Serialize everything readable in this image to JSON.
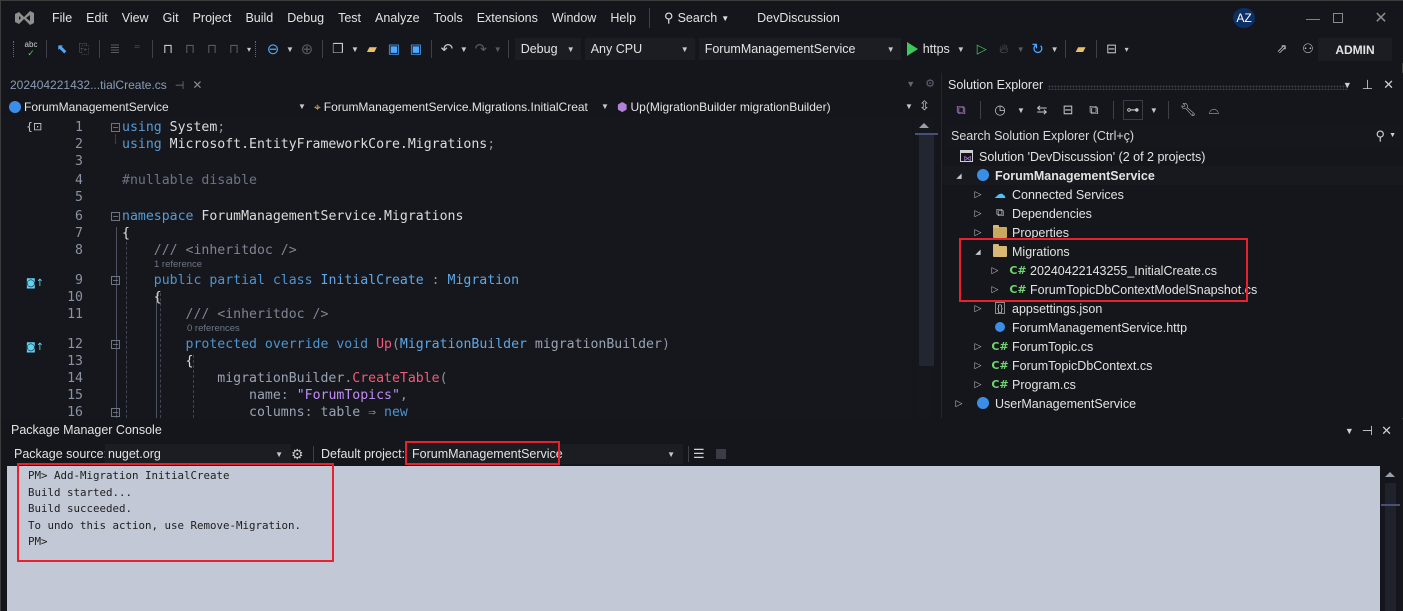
{
  "menubar": {
    "items": [
      "File",
      "Edit",
      "View",
      "Git",
      "Project",
      "Build",
      "Debug",
      "Test",
      "Analyze",
      "Tools",
      "Extensions",
      "Window",
      "Help"
    ],
    "search_label": "Search",
    "solution_name": "DevDiscussion",
    "avatar_initials": "AZ"
  },
  "toolbar": {
    "configuration": "Debug",
    "platform": "Any CPU",
    "startup_project": "ForumManagementService",
    "run_profile": "https",
    "admin_label": "ADMIN"
  },
  "editor": {
    "tab_title": "202404221432...tialCreate.cs",
    "nav_project": "ForumManagementService",
    "nav_type": "ForumManagementService.Migrations.InitialCreat",
    "nav_member": "Up(MigrationBuilder migrationBuilder)",
    "codelens": {
      "class_refs": "1 reference",
      "method_refs": "0 references"
    },
    "lines": [
      {
        "n": "1",
        "tokens": [
          [
            "kw",
            "using"
          ],
          [
            "id",
            " System"
          ],
          [
            "dim",
            ";"
          ]
        ]
      },
      {
        "n": "2",
        "tokens": [
          [
            "kw",
            "using"
          ],
          [
            "id",
            " Microsoft.EntityFrameworkCore.Migrations"
          ],
          [
            "dim",
            ";"
          ]
        ]
      },
      {
        "n": "3",
        "tokens": []
      },
      {
        "n": "4",
        "tokens": [
          [
            "pp",
            "#nullable disable"
          ]
        ]
      },
      {
        "n": "5",
        "tokens": []
      },
      {
        "n": "6",
        "tokens": [
          [
            "kw",
            "namespace"
          ],
          [
            "id",
            " ForumManagementService.Migrations"
          ]
        ]
      },
      {
        "n": "7",
        "tokens": [
          [
            "id",
            "{"
          ]
        ]
      },
      {
        "n": "8",
        "tokens": [
          [
            "cm",
            "    /// <inheritdoc />"
          ]
        ]
      },
      {
        "n": "9",
        "tokens": [
          [
            "kwc",
            "    public partial class "
          ],
          [
            "tyb",
            "InitialCreate"
          ],
          [
            "dim",
            " : "
          ],
          [
            "tyb",
            "Migration"
          ]
        ]
      },
      {
        "n": "10",
        "tokens": [
          [
            "id",
            "    {"
          ]
        ]
      },
      {
        "n": "11",
        "tokens": [
          [
            "cm",
            "        /// <inheritdoc />"
          ]
        ]
      },
      {
        "n": "12",
        "tokens": [
          [
            "kwc",
            "        protected override void "
          ],
          [
            "mth",
            "Up"
          ],
          [
            "dim",
            "("
          ],
          [
            "tyb",
            "MigrationBuilder"
          ],
          [
            "prm",
            " migrationBuilder"
          ],
          [
            "dim",
            ")"
          ]
        ]
      },
      {
        "n": "13",
        "tokens": [
          [
            "id",
            "        {"
          ]
        ]
      },
      {
        "n": "14",
        "tokens": [
          [
            "prm",
            "            migrationBuilder"
          ],
          [
            "dim",
            "."
          ],
          [
            "mth",
            "CreateTable"
          ],
          [
            "dim",
            "("
          ]
        ]
      },
      {
        "n": "15",
        "tokens": [
          [
            "prm",
            "                name"
          ],
          [
            "dim",
            ": "
          ],
          [
            "str",
            "\"ForumTopics\""
          ],
          [
            "dim",
            ","
          ]
        ]
      },
      {
        "n": "16",
        "tokens": [
          [
            "prm",
            "                columns"
          ],
          [
            "dim",
            ": "
          ],
          [
            "prm",
            "table"
          ],
          [
            "dim",
            " ⇒ "
          ],
          [
            "kwc",
            "new"
          ]
        ]
      }
    ]
  },
  "solution_explorer": {
    "title": "Solution Explorer",
    "search_placeholder": "Search Solution Explorer (Ctrl+ç)",
    "solution_label": "Solution 'DevDiscussion' (2 of 2 projects)",
    "items": [
      {
        "label": "ForumManagementService",
        "level": 1,
        "expander": "expanded",
        "icon": "web-project-icon",
        "bold": true
      },
      {
        "label": "Connected Services",
        "level": 2,
        "expander": "collapsed",
        "icon": "connected-services-icon"
      },
      {
        "label": "Dependencies",
        "level": 2,
        "expander": "collapsed",
        "icon": "dependencies-icon"
      },
      {
        "label": "Properties",
        "level": 2,
        "expander": "collapsed",
        "icon": "properties-folder-icon"
      },
      {
        "label": "Migrations",
        "level": 2,
        "expander": "expanded",
        "icon": "folder-icon"
      },
      {
        "label": "20240422143255_InitialCreate.cs",
        "level": 3,
        "expander": "collapsed",
        "icon": "csharp-file-icon"
      },
      {
        "label": "ForumTopicDbContextModelSnapshot.cs",
        "level": 3,
        "expander": "collapsed",
        "icon": "csharp-file-icon"
      },
      {
        "label": "appsettings.json",
        "level": 2,
        "expander": "collapsed",
        "icon": "json-file-icon"
      },
      {
        "label": "ForumManagementService.http",
        "level": 2,
        "expander": "none",
        "icon": "http-file-icon"
      },
      {
        "label": "ForumTopic.cs",
        "level": 2,
        "expander": "collapsed",
        "icon": "csharp-file-icon"
      },
      {
        "label": "ForumTopicDbContext.cs",
        "level": 2,
        "expander": "collapsed",
        "icon": "csharp-file-icon"
      },
      {
        "label": "Program.cs",
        "level": 2,
        "expander": "collapsed",
        "icon": "csharp-file-icon"
      },
      {
        "label": "UserManagementService",
        "level": 1,
        "expander": "collapsed",
        "icon": "web-project-icon"
      }
    ]
  },
  "package_manager_console": {
    "title": "Package Manager Console",
    "package_source_label": "Package source:",
    "package_source_value": "nuget.org",
    "default_project_label": "Default project:",
    "default_project_value": "ForumManagementService",
    "output_lines": [
      "PM> Add-Migration InitialCreate",
      "Build started...",
      "Build succeeded.",
      "To undo this action, use Remove-Migration.",
      "PM>"
    ]
  },
  "colors": {
    "highlight_box": "#e8222c",
    "console_background": "#c3c8d6",
    "run_green": "#3cc85a"
  }
}
